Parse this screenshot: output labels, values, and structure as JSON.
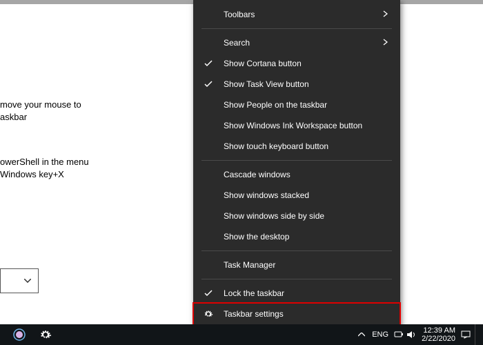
{
  "bg_line1": "move your mouse to",
  "bg_line2": "askbar",
  "bg_line3": "owerShell in the menu",
  "bg_line4": "Windows key+X",
  "menu": {
    "toolbars": "Toolbars",
    "search": "Search",
    "cortana": "Show Cortana button",
    "taskview": "Show Task View button",
    "people": "Show People on the taskbar",
    "ink": "Show Windows Ink Workspace button",
    "touch": "Show touch keyboard button",
    "cascade": "Cascade windows",
    "stacked": "Show windows stacked",
    "sideby": "Show windows side by side",
    "desktop": "Show the desktop",
    "taskmgr": "Task Manager",
    "lock": "Lock the taskbar",
    "settings": "Taskbar settings"
  },
  "tray": {
    "lang": "ENG",
    "time": "12:39 AM",
    "date": "2/22/2020"
  }
}
